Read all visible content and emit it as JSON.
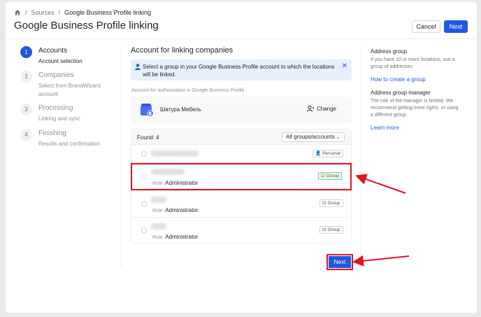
{
  "breadcrumb": {
    "sources": "Sources",
    "current": "Google Business Profile linking",
    "sep": "/"
  },
  "header": {
    "title": "Google Business Profile linking",
    "cancel_label": "Cancel",
    "next_label": "Next"
  },
  "steps": [
    {
      "num": "1",
      "title": "Accounts",
      "sub": "Account selection"
    },
    {
      "num": "2",
      "title": "Companies",
      "sub": "Select from BrandWizard account"
    },
    {
      "num": "3",
      "title": "Processing",
      "sub": "Linking and sync"
    },
    {
      "num": "4",
      "title": "Finishing",
      "sub": "Results and confirmation"
    }
  ],
  "main": {
    "title": "Account for linking companies",
    "info": "Select a group in your Google Business Profile account to which the locations will be linked.",
    "close": "✕",
    "auth_label": "Account for authorization in Google Business Profile",
    "auth_name": "Шатура Мебель",
    "change_label": "Change",
    "found": "Found: 4",
    "filter": "All groups/accounts",
    "role_label": "Role:",
    "role_value": "Administrator",
    "badges": {
      "personal": "Personal",
      "group": "Group"
    },
    "next_label": "Next"
  },
  "sidebar": {
    "group_title": "Address group",
    "group_text": "If you have 10 or more locations, use a group of addresses.",
    "group_link": "How to create a group",
    "manager_title": "Address group manager",
    "manager_text": "The role of the manager is limited. We recommend getting more rights, or using a different group.",
    "manager_link": "Learn more"
  },
  "colors": {
    "accent": "#2158e0",
    "highlight": "#e1141e"
  }
}
